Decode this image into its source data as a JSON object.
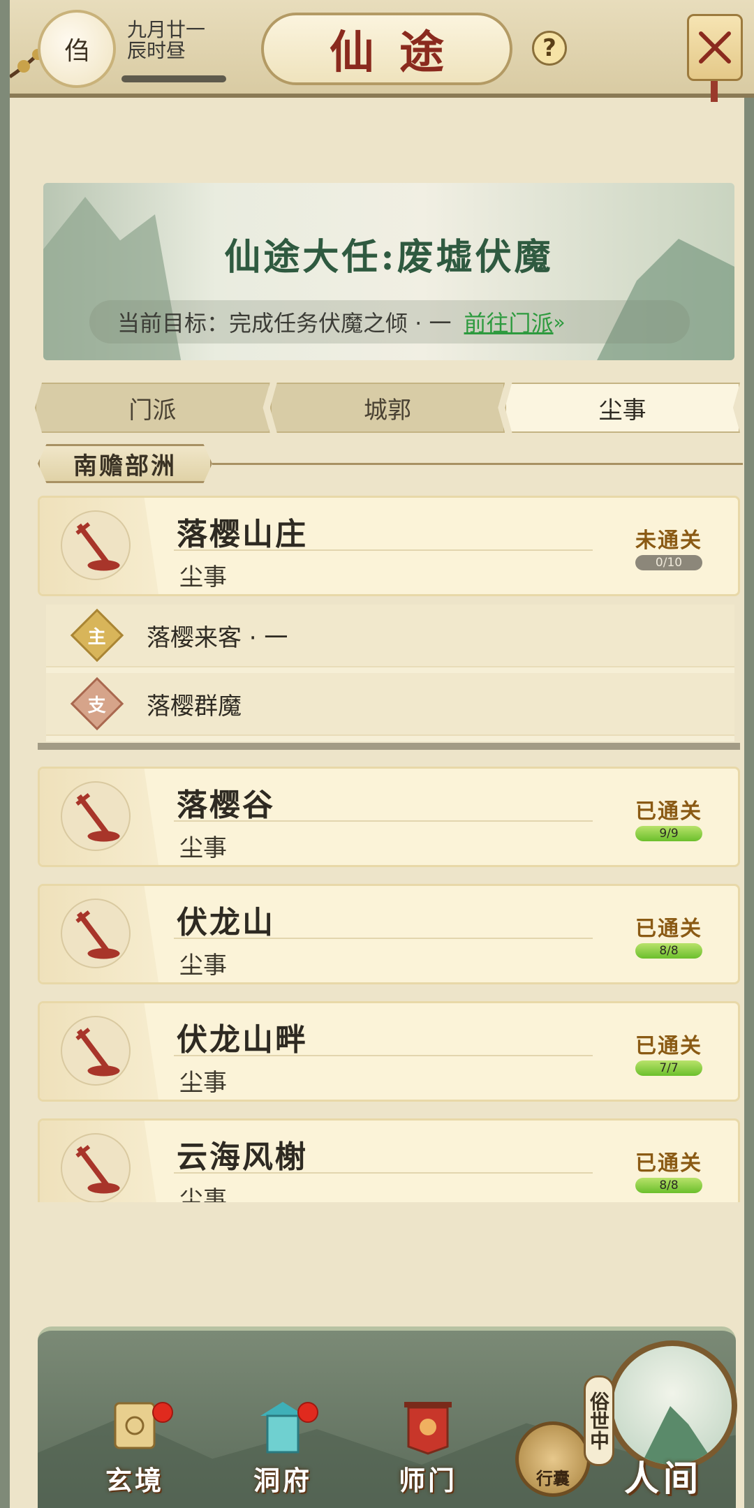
{
  "header": {
    "avatar_label": "㑇",
    "date_line1": "九月廿一",
    "date_line2": "辰时昼",
    "title": "仙途",
    "help_label": "?"
  },
  "banner": {
    "title": "仙途大任:废墟伏魔",
    "goal_text": "当前目标：完成任务伏魔之倾 · 一",
    "goal_link": "前往门派"
  },
  "tabs": [
    {
      "label": "门派",
      "active": false
    },
    {
      "label": "城郭",
      "active": false
    },
    {
      "label": "尘事",
      "active": true
    }
  ],
  "region": "南赡部洲",
  "cards": [
    {
      "name": "落樱山庄",
      "sub": "尘事",
      "status": "未通关",
      "progress": "0/10",
      "done": false
    },
    {
      "name": "落樱谷",
      "sub": "尘事",
      "status": "已通关",
      "progress": "9/9",
      "done": true
    },
    {
      "name": "伏龙山",
      "sub": "尘事",
      "status": "已通关",
      "progress": "8/8",
      "done": true
    },
    {
      "name": "伏龙山畔",
      "sub": "尘事",
      "status": "已通关",
      "progress": "7/7",
      "done": true
    },
    {
      "name": "云海风榭",
      "sub": "尘事",
      "status": "已通关",
      "progress": "8/8",
      "done": true
    }
  ],
  "subtasks": [
    {
      "badge": "主",
      "label": "落樱来客 · 一",
      "type": "main"
    },
    {
      "badge": "支",
      "label": "落樱群魔",
      "type": "side"
    }
  ],
  "nav": {
    "xuanjing": "玄境",
    "dongfu": "洞府",
    "shimen": "师门",
    "bag": "行囊",
    "world_tag": "俗世中",
    "world": "人间"
  },
  "colors": {
    "accent_red": "#8a2a1e",
    "link_green": "#2d9a3e",
    "progress_done": "#6bbf2c"
  }
}
